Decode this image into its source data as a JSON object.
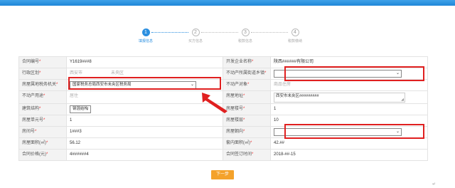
{
  "steps": [
    {
      "num": "1",
      "label": "填报信息"
    },
    {
      "num": "2",
      "label": "买方信息"
    },
    {
      "num": "3",
      "label": "税款信息"
    },
    {
      "num": "4",
      "label": "税款缴纳"
    }
  ],
  "form": {
    "contract_no": {
      "label": "合同编号",
      "value": "Y1619###8"
    },
    "developer": {
      "label": "开发企业名称",
      "value": "陕西######有限公司"
    },
    "district": {
      "label": "行政区划",
      "value_city": "西安市",
      "value_district": "未央区"
    },
    "street": {
      "label": "不动产所属街道乡镇",
      "value": ""
    },
    "tax_authority": {
      "label": "房屋属地税务机关",
      "value": "国家税务总局西安市未央区税务局"
    },
    "property_object": {
      "label": "不动产对象",
      "value": "商品住房"
    },
    "usage": {
      "label": "不动产用途",
      "value": "居住"
    },
    "address": {
      "label": "房屋地址",
      "value": "西安市未央区#########"
    },
    "structure": {
      "label": "建筑结构",
      "value": "钢混结构"
    },
    "building_no": {
      "label": "房屋楼号",
      "value": "1"
    },
    "unit_no": {
      "label": "房屋单元号",
      "value": "1"
    },
    "floor": {
      "label": "房屋楼层",
      "value": "10"
    },
    "room_no": {
      "label": "房间号",
      "value": "1###3"
    },
    "orientation": {
      "label": "房屋朝向",
      "value": ""
    },
    "area": {
      "label": "房屋面积(㎡)",
      "value": "56.12"
    },
    "inner_area": {
      "label": "套内面积(㎡)",
      "value": "42.##"
    },
    "price": {
      "label": "合同价格(元)",
      "value": "4######4"
    },
    "sign_date": {
      "label": "合同签订时间",
      "value": "2018-##-15"
    }
  },
  "buttons": {
    "next": "下一步"
  },
  "corner_mark": "↵",
  "colors": {
    "accent": "#2b8fe0",
    "highlight": "#e02020",
    "button": "#f4a22b"
  }
}
